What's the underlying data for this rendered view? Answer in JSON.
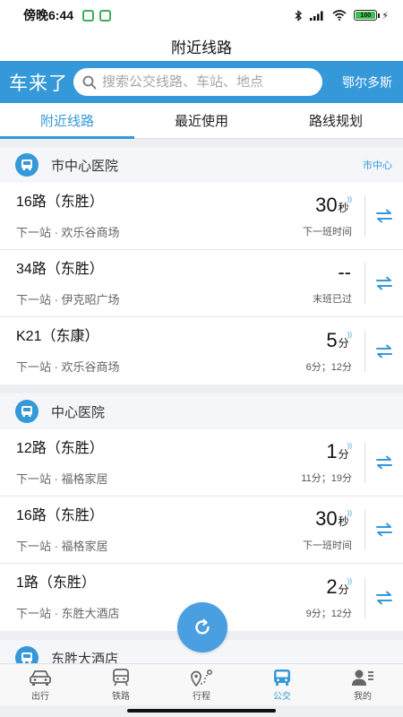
{
  "status_bar": {
    "time": "傍晚6:44",
    "battery": "100",
    "icons": [
      "bluetooth-icon",
      "signal-icon",
      "wifi-icon",
      "battery-icon",
      "charging-icon"
    ]
  },
  "page_title": "附近线路",
  "brand": "车来了",
  "search": {
    "placeholder": "搜索公交线路、车站、地点",
    "value": ""
  },
  "city": "鄂尔多斯",
  "tabs": [
    {
      "label": "附近线路",
      "active": true
    },
    {
      "label": "最近使用",
      "active": false
    },
    {
      "label": "路线规划",
      "active": false
    }
  ],
  "colors": {
    "accent": "#3598d8"
  },
  "stations": [
    {
      "name": "市中心医院",
      "tag": "市中心",
      "routes": [
        {
          "name": "16路（东胜）",
          "next": "下一站 · 欢乐谷商场",
          "eta_num": "30",
          "eta_unit": "秒",
          "sub": "下一班时间"
        },
        {
          "name": "34路（东胜）",
          "next": "下一站 · 伊克昭广场",
          "eta_num": "--",
          "eta_unit": "",
          "sub": "末班已过"
        },
        {
          "name": "K21（东康）",
          "next": "下一站 · 欢乐谷商场",
          "eta_num": "5",
          "eta_unit": "分",
          "sub": "6分；12分"
        }
      ]
    },
    {
      "name": "中心医院",
      "tag": "",
      "routes": [
        {
          "name": "12路（东胜）",
          "next": "下一站 · 福格家居",
          "eta_num": "1",
          "eta_unit": "分",
          "sub": "11分；19分"
        },
        {
          "name": "16路（东胜）",
          "next": "下一站 · 福格家居",
          "eta_num": "30",
          "eta_unit": "秒",
          "sub": "下一班时间"
        },
        {
          "name": "1路（东胜）",
          "next": "下一站 · 东胜大酒店",
          "eta_num": "2",
          "eta_unit": "分",
          "sub": "9分；12分"
        }
      ]
    },
    {
      "name": "东胜大酒店",
      "tag": "",
      "routes": []
    }
  ],
  "bottom_nav": [
    {
      "label": "出行",
      "icon": "car-icon",
      "active": false
    },
    {
      "label": "铁路",
      "icon": "train-icon",
      "active": false
    },
    {
      "label": "行程",
      "icon": "route-pin-icon",
      "active": false
    },
    {
      "label": "公交",
      "icon": "bus-icon",
      "active": true
    },
    {
      "label": "我的",
      "icon": "profile-icon",
      "active": false
    }
  ]
}
